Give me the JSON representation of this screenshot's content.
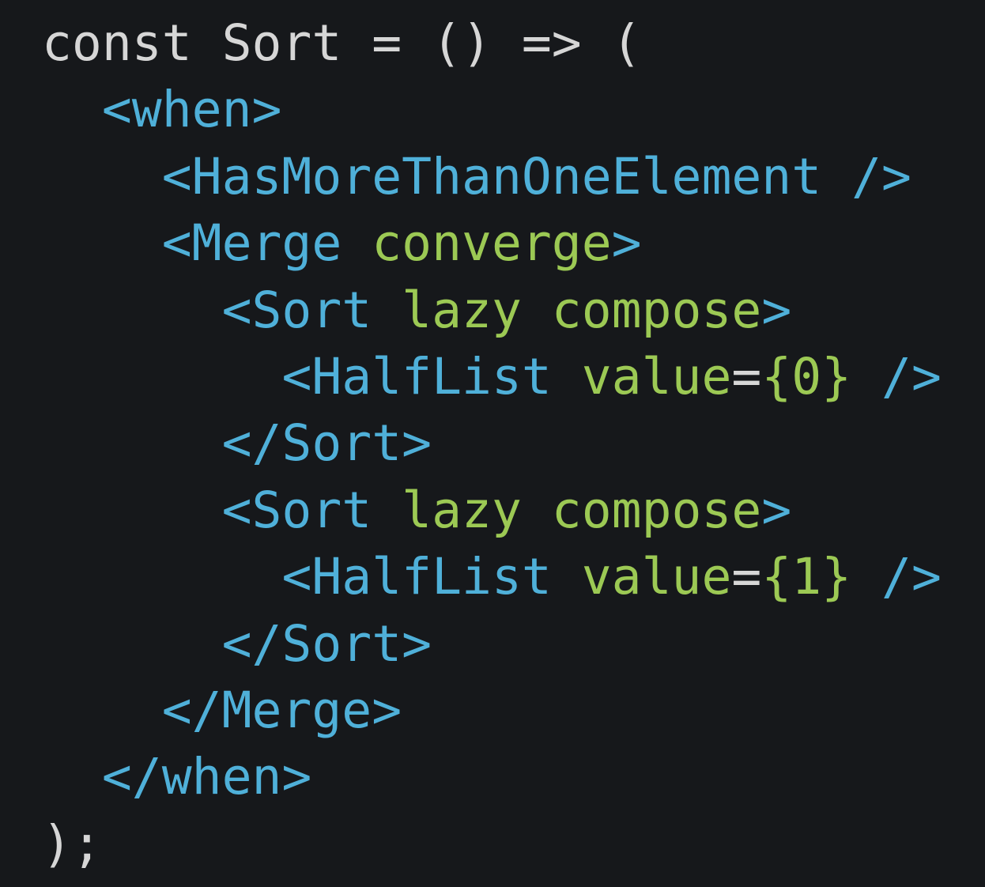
{
  "code": {
    "colors": {
      "background": "#16181b",
      "plain": "#d6d6d6",
      "tag": "#4fb0d9",
      "attr": "#9cc954"
    },
    "lines": [
      {
        "indent": "",
        "tokens": [
          {
            "text": "const Sort = () => (",
            "kind": "plain"
          }
        ]
      },
      {
        "indent": "  ",
        "tokens": [
          {
            "text": "<when>",
            "kind": "tag"
          }
        ]
      },
      {
        "indent": "    ",
        "tokens": [
          {
            "text": "<HasMoreThanOneElement />",
            "kind": "tag"
          }
        ]
      },
      {
        "indent": "    ",
        "tokens": [
          {
            "text": "<Merge ",
            "kind": "tag"
          },
          {
            "text": "converge",
            "kind": "attr"
          },
          {
            "text": ">",
            "kind": "tag"
          }
        ]
      },
      {
        "indent": "      ",
        "tokens": [
          {
            "text": "<Sort ",
            "kind": "tag"
          },
          {
            "text": "lazy compose",
            "kind": "attr"
          },
          {
            "text": ">",
            "kind": "tag"
          }
        ]
      },
      {
        "indent": "        ",
        "tokens": [
          {
            "text": "<HalfList ",
            "kind": "tag"
          },
          {
            "text": "value",
            "kind": "attr"
          },
          {
            "text": "=",
            "kind": "plain"
          },
          {
            "text": "{0}",
            "kind": "attr"
          },
          {
            "text": " />",
            "kind": "tag"
          }
        ]
      },
      {
        "indent": "      ",
        "tokens": [
          {
            "text": "</Sort>",
            "kind": "tag"
          }
        ]
      },
      {
        "indent": "      ",
        "tokens": [
          {
            "text": "<Sort ",
            "kind": "tag"
          },
          {
            "text": "lazy compose",
            "kind": "attr"
          },
          {
            "text": ">",
            "kind": "tag"
          }
        ]
      },
      {
        "indent": "        ",
        "tokens": [
          {
            "text": "<HalfList ",
            "kind": "tag"
          },
          {
            "text": "value",
            "kind": "attr"
          },
          {
            "text": "=",
            "kind": "plain"
          },
          {
            "text": "{1}",
            "kind": "attr"
          },
          {
            "text": " />",
            "kind": "tag"
          }
        ]
      },
      {
        "indent": "      ",
        "tokens": [
          {
            "text": "</Sort>",
            "kind": "tag"
          }
        ]
      },
      {
        "indent": "    ",
        "tokens": [
          {
            "text": "</Merge>",
            "kind": "tag"
          }
        ]
      },
      {
        "indent": "  ",
        "tokens": [
          {
            "text": "</when>",
            "kind": "tag"
          }
        ]
      },
      {
        "indent": "",
        "tokens": [
          {
            "text": ");",
            "kind": "plain"
          }
        ]
      }
    ]
  }
}
